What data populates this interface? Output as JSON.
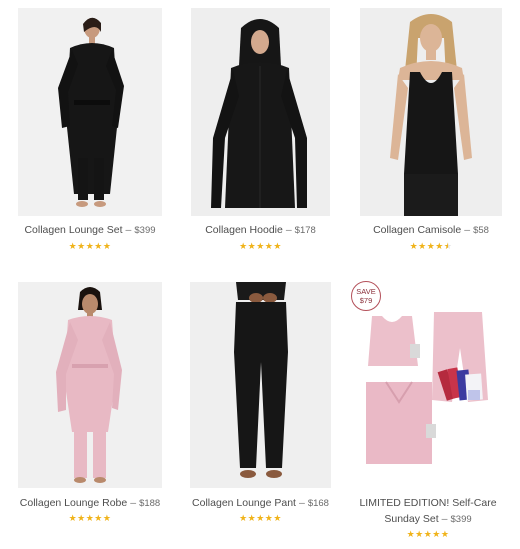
{
  "products": [
    {
      "name": "Collagen Lounge Set",
      "price": "$399",
      "rating": 5
    },
    {
      "name": "Collagen Hoodie",
      "price": "$178",
      "rating": 5
    },
    {
      "name": "Collagen Camisole",
      "price": "$58",
      "rating": 4.5
    },
    {
      "name": "Collagen Lounge Robe",
      "price": "$188",
      "rating": 5
    },
    {
      "name": "Collagen Lounge Pant",
      "price": "$168",
      "rating": 5
    },
    {
      "name_line1": "LIMITED EDITION! Self-Care",
      "name_line2": "Sunday Set",
      "price": "$399",
      "rating": 5,
      "badge_line1": "SAVE",
      "badge_line2": "$79"
    }
  ],
  "separator": "–",
  "star_glyph": "★★★★★",
  "star_glyph_4": "★★★★",
  "half_star": "★",
  "colors": {
    "star": "#f0b31a",
    "badge_border": "#b4505a",
    "garment_black": "#161616",
    "garment_pink": "#e8b9c4"
  }
}
